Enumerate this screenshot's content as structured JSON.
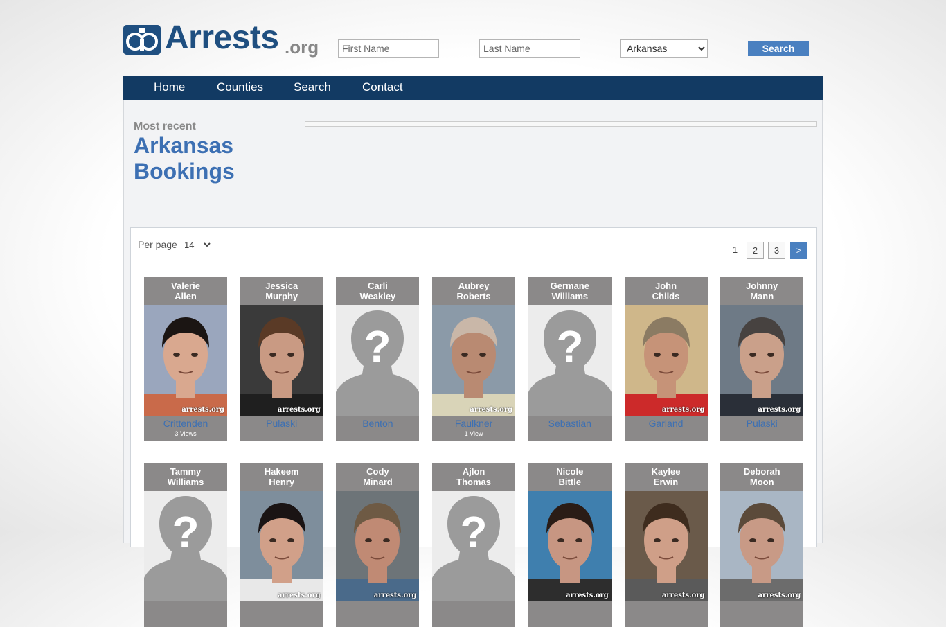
{
  "header": {
    "logo_text": "Arrests",
    "logo_tld": ".org",
    "first_name_placeholder": "First Name",
    "last_name_placeholder": "Last Name",
    "state_selected": "Arkansas",
    "search_label": "Search"
  },
  "nav": {
    "items": [
      {
        "label": "Home"
      },
      {
        "label": "Counties"
      },
      {
        "label": "Search"
      },
      {
        "label": "Contact"
      }
    ]
  },
  "main": {
    "kicker": "Most recent",
    "title_line1": "Arkansas",
    "title_line2": "Bookings"
  },
  "listing": {
    "per_page_label": "Per page",
    "per_page_value": "14",
    "pagination": [
      "1",
      "2",
      "3",
      ">"
    ],
    "colors": {
      "card_bg": "#8b8989",
      "county_link": "#3d70b3",
      "nav_bg": "#123a63",
      "button_bg": "#4a80c0"
    },
    "records": [
      {
        "first": "Valerie",
        "last": "Allen",
        "county": "Crittenden",
        "views": "3 Views",
        "photo": "mugshot"
      },
      {
        "first": "Jessica",
        "last": "Murphy",
        "county": "Pulaski",
        "views": "",
        "photo": "mugshot"
      },
      {
        "first": "Carli",
        "last": "Weakley",
        "county": "Benton",
        "views": "",
        "photo": "placeholder"
      },
      {
        "first": "Aubrey",
        "last": "Roberts",
        "county": "Faulkner",
        "views": "1 View",
        "photo": "mugshot"
      },
      {
        "first": "Germane",
        "last": "Williams",
        "county": "Sebastian",
        "views": "",
        "photo": "placeholder"
      },
      {
        "first": "John",
        "last": "Childs",
        "county": "Garland",
        "views": "",
        "photo": "mugshot"
      },
      {
        "first": "Johnny",
        "last": "Mann",
        "county": "Pulaski",
        "views": "",
        "photo": "mugshot"
      },
      {
        "first": "Tammy",
        "last": "Williams",
        "county": "",
        "views": "",
        "photo": "placeholder"
      },
      {
        "first": "Hakeem",
        "last": "Henry",
        "county": "",
        "views": "",
        "photo": "mugshot"
      },
      {
        "first": "Cody",
        "last": "Minard",
        "county": "",
        "views": "",
        "photo": "mugshot"
      },
      {
        "first": "Ajlon",
        "last": "Thomas",
        "county": "",
        "views": "",
        "photo": "placeholder"
      },
      {
        "first": "Nicole",
        "last": "Bittle",
        "county": "",
        "views": "",
        "photo": "mugshot"
      },
      {
        "first": "Kaylee",
        "last": "Erwin",
        "county": "",
        "views": "",
        "photo": "mugshot"
      },
      {
        "first": "Deborah",
        "last": "Moon",
        "county": "",
        "views": "",
        "photo": "mugshot"
      }
    ],
    "watermark": "arrests.org"
  }
}
